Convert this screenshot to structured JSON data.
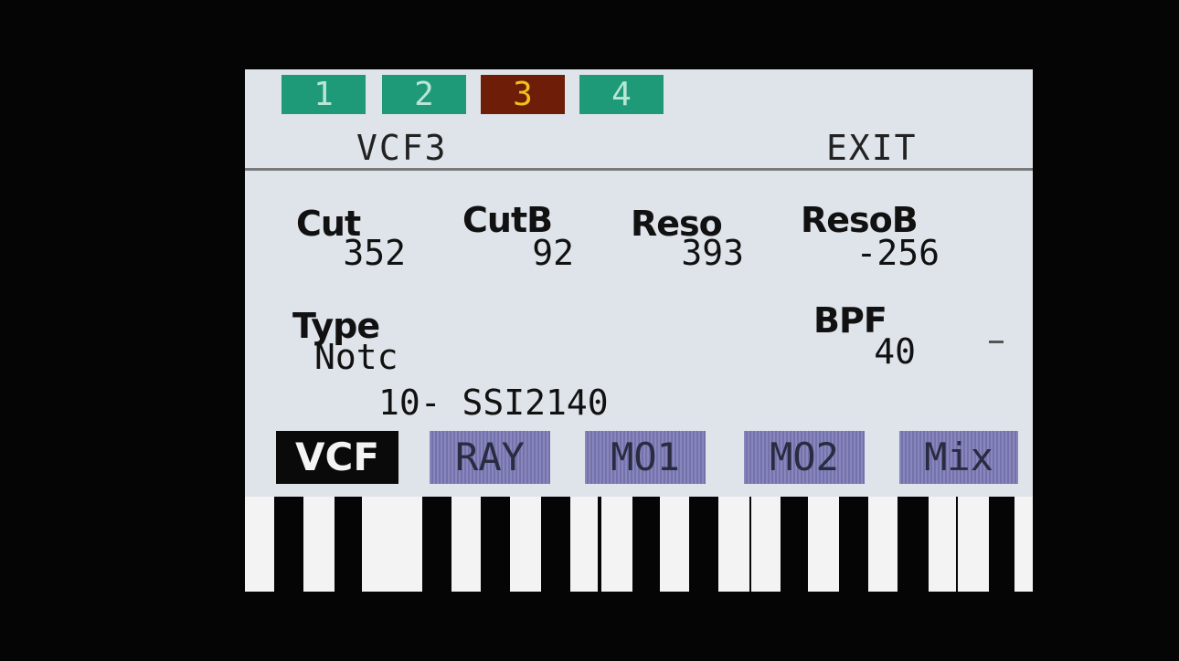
{
  "tabs": [
    {
      "label": "1",
      "state": "normal"
    },
    {
      "label": "2",
      "state": "normal"
    },
    {
      "label": "3",
      "state": "active"
    },
    {
      "label": "4",
      "state": "normal"
    }
  ],
  "header": {
    "title": "VCF3",
    "exit_label": "EXIT"
  },
  "params": {
    "cut": {
      "label": "Cut",
      "value": "352"
    },
    "cutb": {
      "label": "CutB",
      "value": "92"
    },
    "reso": {
      "label": "Reso",
      "value": "393"
    },
    "resob": {
      "label": "ResoB",
      "value": "-256"
    },
    "type": {
      "label": "Type",
      "value": "Notc"
    },
    "bpf": {
      "label": "BPF",
      "value": "40"
    }
  },
  "filter_model": "10- SSI2140",
  "bottom_buttons": [
    {
      "label": "VCF",
      "selected": true
    },
    {
      "label": "RAY",
      "selected": false
    },
    {
      "label": "MO1",
      "selected": false
    },
    {
      "label": "MO2",
      "selected": false
    },
    {
      "label": "Mix",
      "selected": false
    }
  ],
  "colors": {
    "screen_bg": "#dfe4ea",
    "tab_green": "#1f9a78",
    "tab_active": "#6e1e08",
    "tab_active_text": "#f0c21a",
    "button_purple": "#7a78b4",
    "button_selected": "#0a0a0a"
  }
}
